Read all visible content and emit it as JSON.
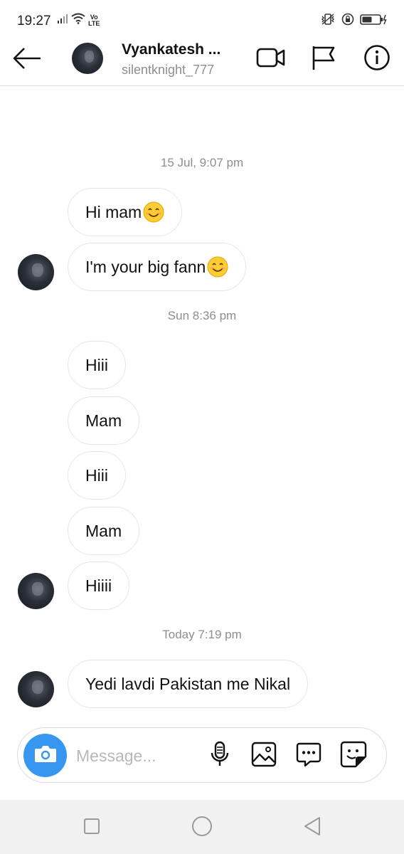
{
  "status_bar": {
    "time": "19:27",
    "volte_top": "Vo",
    "volte_bottom": "LTE"
  },
  "header": {
    "name": "Vyankatesh ...",
    "username": "silentknight_777",
    "icons": [
      "back-arrow-icon",
      "video-call-icon",
      "flag-icon",
      "info-icon"
    ]
  },
  "chat": {
    "timestamps": [
      "15 Jul, 9:07 pm",
      "Sun 8:36 pm",
      "Today 7:19 pm"
    ],
    "messages": [
      {
        "text": "Hi mam",
        "emoji": "smile"
      },
      {
        "text": "I'm your big fann",
        "emoji": "smile"
      },
      {
        "text": "Hiii"
      },
      {
        "text": "Mam"
      },
      {
        "text": "Hiii"
      },
      {
        "text": "Mam"
      },
      {
        "text": "Hiiii"
      },
      {
        "text": "Yedi lavdi Pakistan me Nikal"
      }
    ]
  },
  "composer": {
    "placeholder": "Message...",
    "value": "",
    "icons": [
      "camera-icon",
      "microphone-icon",
      "gallery-icon",
      "more-icon",
      "sticker-icon"
    ]
  },
  "colors": {
    "accent": "#3797f0",
    "muted_text": "#8e8e8e",
    "bubble_border": "#e6e6e6",
    "nav_bg": "#f1f1f1"
  }
}
